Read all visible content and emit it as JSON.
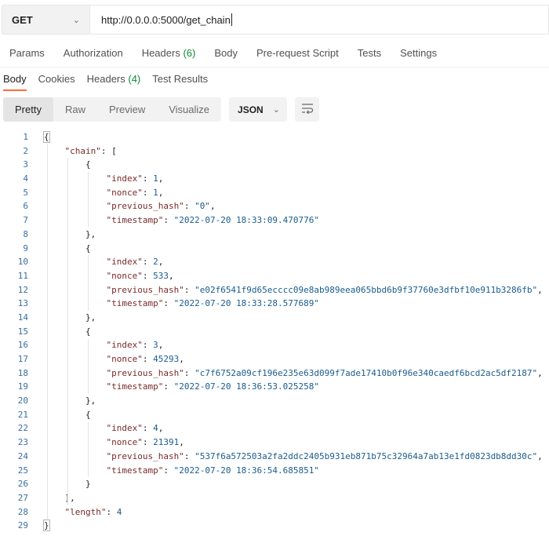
{
  "request": {
    "method": "GET",
    "method_chevron": "⌄",
    "url": "http://0.0.0.0:5000/get_chain"
  },
  "request_tabs": [
    {
      "label": "Params"
    },
    {
      "label": "Authorization"
    },
    {
      "label": "Headers",
      "count": "(6)"
    },
    {
      "label": "Body"
    },
    {
      "label": "Pre-request Script"
    },
    {
      "label": "Tests"
    },
    {
      "label": "Settings"
    }
  ],
  "response_tabs": [
    {
      "label": "Body",
      "active": true
    },
    {
      "label": "Cookies"
    },
    {
      "label": "Headers",
      "count": "(4)"
    },
    {
      "label": "Test Results"
    }
  ],
  "view_modes": [
    {
      "label": "Pretty",
      "active": true
    },
    {
      "label": "Raw"
    },
    {
      "label": "Preview"
    },
    {
      "label": "Visualize"
    }
  ],
  "format": {
    "label": "JSON",
    "chevron": "⌄"
  },
  "icons": {
    "wrap": "wrap-lines-icon"
  },
  "colors": {
    "accent": "#ff6c37",
    "count": "#0f8a36",
    "key": "#7a2a2a",
    "value": "#1a5c8c",
    "line_number": "#3a6fa0"
  },
  "json_lines": [
    [
      {
        "t": "p",
        "v": "{"
      }
    ],
    [
      {
        "t": "p",
        "v": "    "
      },
      {
        "t": "k",
        "v": "\"chain\""
      },
      {
        "t": "p",
        "v": ": ["
      }
    ],
    [
      {
        "t": "p",
        "v": "        {"
      }
    ],
    [
      {
        "t": "p",
        "v": "            "
      },
      {
        "t": "k",
        "v": "\"index\""
      },
      {
        "t": "p",
        "v": ": "
      },
      {
        "t": "n",
        "v": "1"
      },
      {
        "t": "p",
        "v": ","
      }
    ],
    [
      {
        "t": "p",
        "v": "            "
      },
      {
        "t": "k",
        "v": "\"nonce\""
      },
      {
        "t": "p",
        "v": ": "
      },
      {
        "t": "n",
        "v": "1"
      },
      {
        "t": "p",
        "v": ","
      }
    ],
    [
      {
        "t": "p",
        "v": "            "
      },
      {
        "t": "k",
        "v": "\"previous_hash\""
      },
      {
        "t": "p",
        "v": ": "
      },
      {
        "t": "s",
        "v": "\"0\""
      },
      {
        "t": "p",
        "v": ","
      }
    ],
    [
      {
        "t": "p",
        "v": "            "
      },
      {
        "t": "k",
        "v": "\"timestamp\""
      },
      {
        "t": "p",
        "v": ": "
      },
      {
        "t": "s",
        "v": "\"2022-07-20 18:33:09.470776\""
      }
    ],
    [
      {
        "t": "p",
        "v": "        },"
      }
    ],
    [
      {
        "t": "p",
        "v": "        {"
      }
    ],
    [
      {
        "t": "p",
        "v": "            "
      },
      {
        "t": "k",
        "v": "\"index\""
      },
      {
        "t": "p",
        "v": ": "
      },
      {
        "t": "n",
        "v": "2"
      },
      {
        "t": "p",
        "v": ","
      }
    ],
    [
      {
        "t": "p",
        "v": "            "
      },
      {
        "t": "k",
        "v": "\"nonce\""
      },
      {
        "t": "p",
        "v": ": "
      },
      {
        "t": "n",
        "v": "533"
      },
      {
        "t": "p",
        "v": ","
      }
    ],
    [
      {
        "t": "p",
        "v": "            "
      },
      {
        "t": "k",
        "v": "\"previous_hash\""
      },
      {
        "t": "p",
        "v": ": "
      },
      {
        "t": "s",
        "v": "\"e02f6541f9d65ecccc09e8ab989eea065bbd6b9f37760e3dfbf10e911b3286fb\""
      },
      {
        "t": "p",
        "v": ","
      }
    ],
    [
      {
        "t": "p",
        "v": "            "
      },
      {
        "t": "k",
        "v": "\"timestamp\""
      },
      {
        "t": "p",
        "v": ": "
      },
      {
        "t": "s",
        "v": "\"2022-07-20 18:33:28.577689\""
      }
    ],
    [
      {
        "t": "p",
        "v": "        },"
      }
    ],
    [
      {
        "t": "p",
        "v": "        {"
      }
    ],
    [
      {
        "t": "p",
        "v": "            "
      },
      {
        "t": "k",
        "v": "\"index\""
      },
      {
        "t": "p",
        "v": ": "
      },
      {
        "t": "n",
        "v": "3"
      },
      {
        "t": "p",
        "v": ","
      }
    ],
    [
      {
        "t": "p",
        "v": "            "
      },
      {
        "t": "k",
        "v": "\"nonce\""
      },
      {
        "t": "p",
        "v": ": "
      },
      {
        "t": "n",
        "v": "45293"
      },
      {
        "t": "p",
        "v": ","
      }
    ],
    [
      {
        "t": "p",
        "v": "            "
      },
      {
        "t": "k",
        "v": "\"previous_hash\""
      },
      {
        "t": "p",
        "v": ": "
      },
      {
        "t": "s",
        "v": "\"c7f6752a09cf196e235e63d099f7ade17410b0f96e340caedf6bcd2ac5df2187\""
      },
      {
        "t": "p",
        "v": ","
      }
    ],
    [
      {
        "t": "p",
        "v": "            "
      },
      {
        "t": "k",
        "v": "\"timestamp\""
      },
      {
        "t": "p",
        "v": ": "
      },
      {
        "t": "s",
        "v": "\"2022-07-20 18:36:53.025258\""
      }
    ],
    [
      {
        "t": "p",
        "v": "        },"
      }
    ],
    [
      {
        "t": "p",
        "v": "        {"
      }
    ],
    [
      {
        "t": "p",
        "v": "            "
      },
      {
        "t": "k",
        "v": "\"index\""
      },
      {
        "t": "p",
        "v": ": "
      },
      {
        "t": "n",
        "v": "4"
      },
      {
        "t": "p",
        "v": ","
      }
    ],
    [
      {
        "t": "p",
        "v": "            "
      },
      {
        "t": "k",
        "v": "\"nonce\""
      },
      {
        "t": "p",
        "v": ": "
      },
      {
        "t": "n",
        "v": "21391"
      },
      {
        "t": "p",
        "v": ","
      }
    ],
    [
      {
        "t": "p",
        "v": "            "
      },
      {
        "t": "k",
        "v": "\"previous_hash\""
      },
      {
        "t": "p",
        "v": ": "
      },
      {
        "t": "s",
        "v": "\"537f6a572503a2fa2ddc2405b931eb871b75c32964a7ab13e1fd0823db8dd30c\""
      },
      {
        "t": "p",
        "v": ","
      }
    ],
    [
      {
        "t": "p",
        "v": "            "
      },
      {
        "t": "k",
        "v": "\"timestamp\""
      },
      {
        "t": "p",
        "v": ": "
      },
      {
        "t": "s",
        "v": "\"2022-07-20 18:36:54.685851\""
      }
    ],
    [
      {
        "t": "p",
        "v": "        }"
      }
    ],
    [
      {
        "t": "p",
        "v": "    ],"
      }
    ],
    [
      {
        "t": "p",
        "v": "    "
      },
      {
        "t": "k",
        "v": "\"length\""
      },
      {
        "t": "p",
        "v": ": "
      },
      {
        "t": "n",
        "v": "4"
      }
    ],
    [
      {
        "t": "p",
        "v": "}"
      }
    ]
  ]
}
